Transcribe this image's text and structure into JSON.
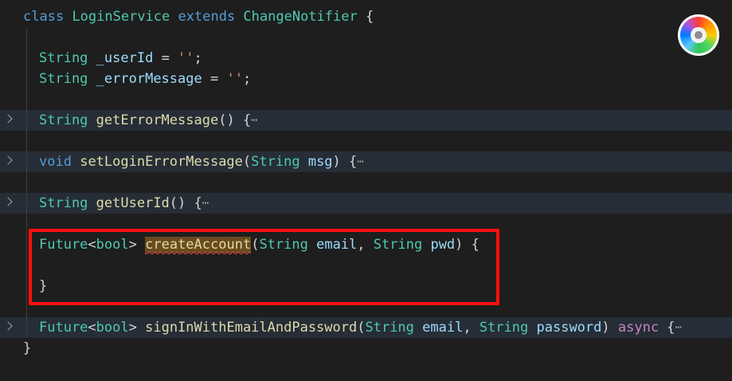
{
  "editor": {
    "lines": {
      "class_decl": {
        "kw_class": "class",
        "class_name": "LoginService",
        "kw_extends": "extends",
        "super_name": "ChangeNotifier",
        "brace": " {"
      },
      "field_userid": {
        "type": "String",
        "name": "_userId",
        "eq": " = ",
        "value": "''",
        "semi": ";"
      },
      "field_error": {
        "type": "String",
        "name": "_errorMessage",
        "eq": " = ",
        "value": "''",
        "semi": ";"
      },
      "get_error": {
        "type": "String",
        "name": "getErrorMessage",
        "rest": "() {",
        "ellipsis": "⋯"
      },
      "set_error": {
        "kw": "void",
        "name": "setLoginErrorMessage",
        "open": "(",
        "ptype": "String",
        "pname": "msg",
        "rest": ") {",
        "ellipsis": "⋯"
      },
      "get_userid": {
        "type": "String",
        "name": "getUserId",
        "rest": "() {",
        "ellipsis": "⋯"
      },
      "create_account": {
        "type": "Future",
        "generic_open": "<",
        "generic_type": "bool",
        "generic_close": ">",
        "name": "createAccount",
        "open": "(",
        "p1type": "String",
        "p1name": "email",
        "comma": ", ",
        "p2type": "String",
        "p2name": "pwd",
        "rest": ") {"
      },
      "create_account_close": {
        "brace": "}"
      },
      "sign_in": {
        "type": "Future",
        "generic_open": "<",
        "generic_type": "bool",
        "generic_close": ">",
        "name": "signInWithEmailAndPassword",
        "open": "(",
        "p1type": "String",
        "p1name": "email",
        "comma": ", ",
        "p2type": "String",
        "p2name": "password",
        "close": ") ",
        "kw_async": "async",
        "rest": " {",
        "ellipsis": "⋯"
      },
      "class_close": {
        "brace": "}"
      }
    },
    "highlight_color": "#ff1010",
    "icons": {
      "fold": "chevron-right-icon",
      "app": "color-wheel-icon"
    }
  }
}
